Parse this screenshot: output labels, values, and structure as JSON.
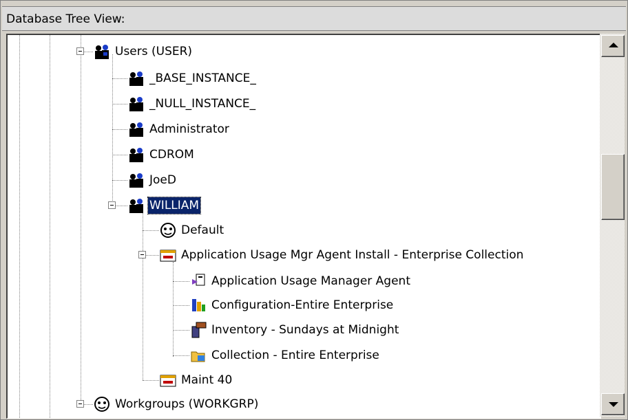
{
  "panel": {
    "title": "Database Tree View:"
  },
  "tree": {
    "users": "Users (USER)",
    "base_instance": "_BASE_INSTANCE_",
    "null_instance": "_NULL_INSTANCE_",
    "administrator": "Administrator",
    "cdrom": "CDROM",
    "joed": "JoeD",
    "william": "WILLIAM",
    "default": "Default",
    "app_usage_install": "Application Usage Mgr Agent Install - Enterprise Collection",
    "app_usage_agent": "Application  Usage Manager Agent",
    "config_enterprise": "Configuration-Entire Enterprise",
    "inventory": "Inventory - Sundays at Midnight",
    "collection": "Collection - Entire Enterprise",
    "maint": "Maint 40",
    "workgroups": "Workgroups (WORKGRP)"
  },
  "colors": {
    "selection": "#0a246a",
    "window_bg": "#d4d0c8"
  }
}
